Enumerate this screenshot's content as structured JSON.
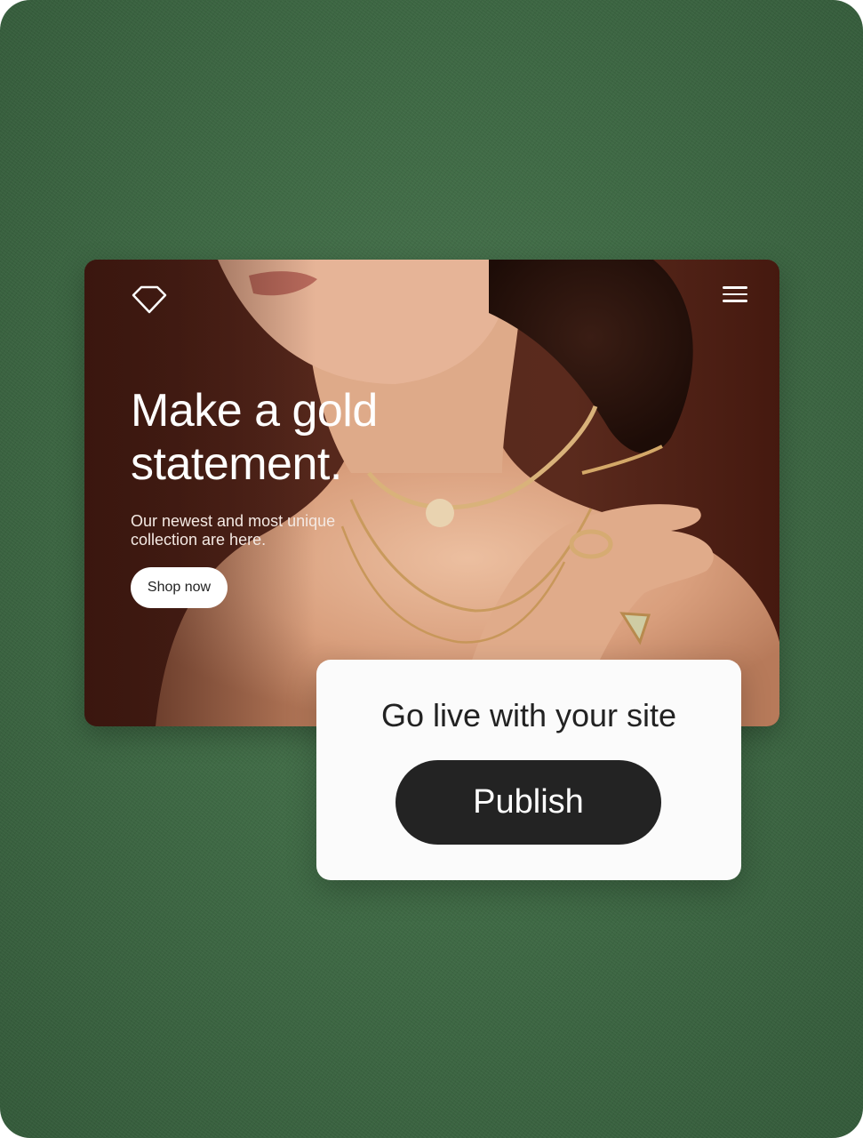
{
  "hero": {
    "logo_icon": "diamond-icon",
    "menu_icon": "hamburger-menu-icon",
    "headline": "Make a gold statement.",
    "subtext": "Our newest and most unique collection are here.",
    "cta_label": "Shop now"
  },
  "publish": {
    "title": "Go live with your site",
    "button_label": "Publish"
  },
  "colors": {
    "background": "#3f6a45",
    "hero_dark": "#4a2116",
    "publish_button": "#232323",
    "card": "#fbfbfb"
  }
}
